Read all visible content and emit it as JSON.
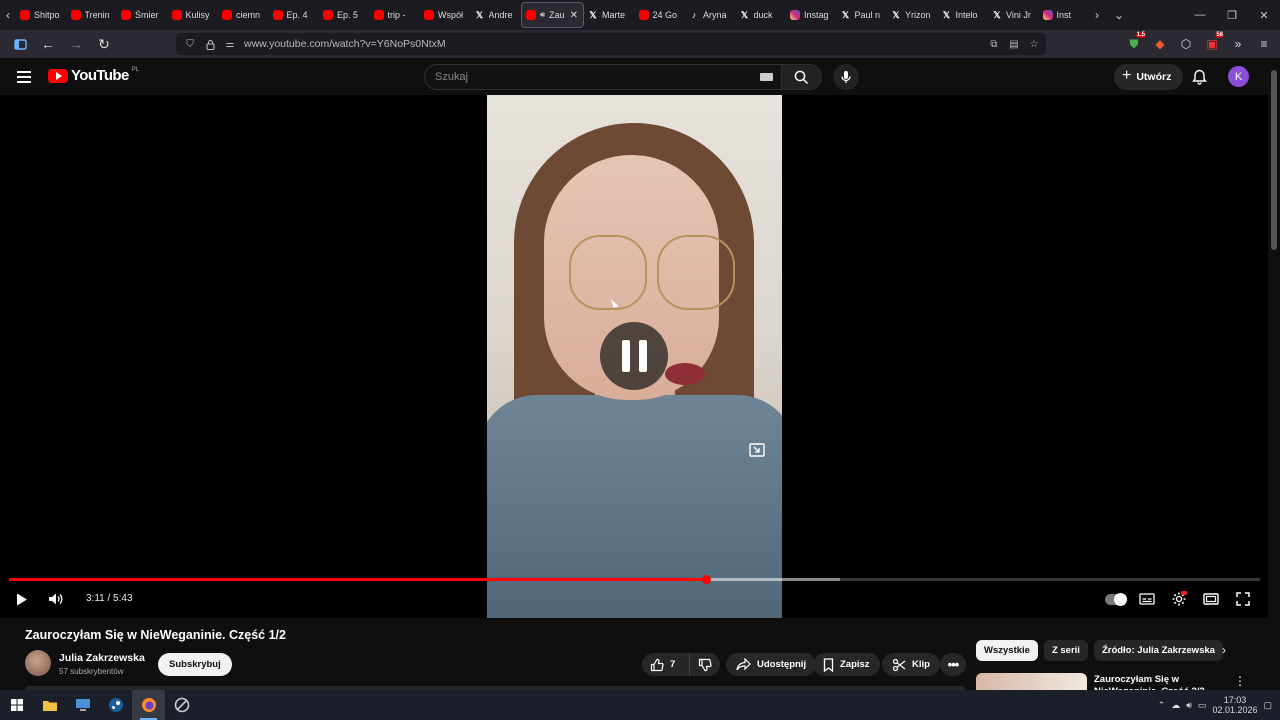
{
  "browser": {
    "tabs": [
      {
        "label": "Shitpo",
        "icon": "youtube-favicon"
      },
      {
        "label": "Trenin",
        "icon": "youtube-favicon"
      },
      {
        "label": "Śmier",
        "icon": "youtube-favicon"
      },
      {
        "label": "Kulisy",
        "icon": "youtube-favicon"
      },
      {
        "label": "ciemn",
        "icon": "youtube-favicon"
      },
      {
        "label": "Ep. 4",
        "icon": "youtube-favicon"
      },
      {
        "label": "Ep. 5",
        "icon": "youtube-favicon"
      },
      {
        "label": "trip -",
        "icon": "youtube-favicon"
      },
      {
        "label": "Współ",
        "icon": "youtube-favicon"
      },
      {
        "label": "Andre",
        "icon": "x-favicon"
      },
      {
        "label": "Zau",
        "icon": "youtube-favicon",
        "active": true
      },
      {
        "label": "Marte",
        "icon": "x-favicon"
      },
      {
        "label": "24 Go",
        "icon": "youtube-favicon"
      },
      {
        "label": "Aryna",
        "icon": "tiktok-favicon"
      },
      {
        "label": "duck",
        "icon": "x-favicon"
      },
      {
        "label": "Instag",
        "icon": "instagram-favicon"
      },
      {
        "label": "Paul n",
        "icon": "x-favicon"
      },
      {
        "label": "Yrizon",
        "icon": "x-favicon"
      },
      {
        "label": "Intelo",
        "icon": "x-favicon"
      },
      {
        "label": "Vini Jr",
        "icon": "x-favicon"
      },
      {
        "label": "Inst",
        "icon": "instagram-favicon"
      }
    ],
    "url": "www.youtube.com/watch?v=Y6NoPs0NtxM",
    "extension_badges": {
      "shield": "1.5",
      "extension": "58"
    }
  },
  "youtube": {
    "logo_text": "YouTube",
    "logo_country": "PL",
    "search_placeholder": "Szukaj",
    "create_label": "Utwórz",
    "avatar_letter": "K"
  },
  "player": {
    "current_time": "3:11",
    "duration": "5:43",
    "time_display": "3:11 / 5:43",
    "state": "paused-overlay",
    "accent": "#ff0000"
  },
  "video": {
    "title": "Zauroczyłam Się w NieWeganinie. Część 1/2",
    "channel": "Julia Zakrzewska",
    "subscribers": "57 subskrybentów",
    "subscribe_label": "Subskrybuj",
    "likes": "7",
    "share_label": "Udostępnij",
    "save_label": "Zapisz",
    "clip_label": "Klip"
  },
  "sidebar": {
    "chips": [
      "Wszystkie",
      "Z serii",
      "Źródło: Julia Zakrzewska"
    ],
    "recommendation_title": "Zauroczyłam Się w NieWeganinie. Część 2/2"
  },
  "taskbar": {
    "time": "17:03",
    "date": "02.01.2026"
  }
}
